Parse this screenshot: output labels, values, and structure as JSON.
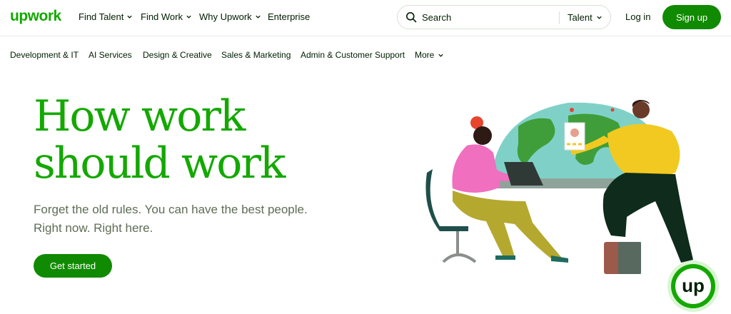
{
  "brand": {
    "logo_text": "upwork",
    "accent": "#14a800",
    "button_green": "#108a00"
  },
  "topnav": {
    "items": [
      {
        "label": "Find Talent",
        "has_dropdown": true
      },
      {
        "label": "Find Work",
        "has_dropdown": true
      },
      {
        "label": "Why Upwork",
        "has_dropdown": true
      },
      {
        "label": "Enterprise",
        "has_dropdown": false
      }
    ],
    "search": {
      "placeholder": "Search",
      "scope": "Talent",
      "icon": "search-icon"
    },
    "login_label": "Log in",
    "signup_label": "Sign up"
  },
  "categories": {
    "items": [
      "Development & IT",
      "AI Services",
      "Design & Creative",
      "Sales & Marketing",
      "Admin & Customer Support"
    ],
    "more_label": "More"
  },
  "hero": {
    "title_line1": "How work",
    "title_line2": "should work",
    "subtitle_line1": "Forget the old rules. You can have the best people.",
    "subtitle_line2": "Right now. Right here.",
    "cta_label": "Get started"
  },
  "badge": {
    "text": "up"
  }
}
